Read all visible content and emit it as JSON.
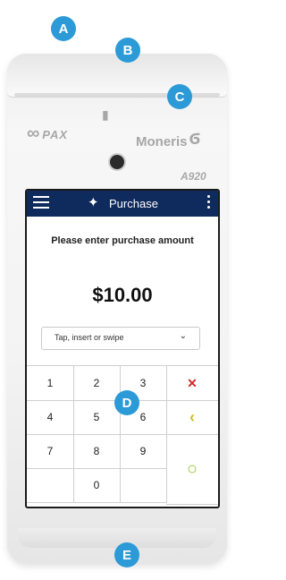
{
  "device": {
    "brand_left": "PAX",
    "brand_right": "Moneris",
    "model": "A920"
  },
  "screen": {
    "topbar": {
      "title": "Purchase"
    },
    "prompt": "Please enter purchase amount",
    "amount": "$10.00",
    "entry_method": {
      "selected": "Tap, insert or swipe"
    }
  },
  "keypad": {
    "rows": [
      [
        "1",
        "2",
        "3"
      ],
      [
        "4",
        "5",
        "6"
      ],
      [
        "7",
        "8",
        "9"
      ],
      [
        "",
        "0",
        ""
      ]
    ],
    "actions": {
      "cancel": "✕",
      "back": "‹",
      "ok": "○"
    }
  },
  "markers": [
    "A",
    "B",
    "C",
    "D",
    "E"
  ],
  "colors": {
    "marker": "#2d9ad8",
    "topbar": "#0f2a5c",
    "cancel": "#d12a2a",
    "back": "#c9c22a",
    "ok": "#9ac43a"
  },
  "icons": [
    "hamburger-icon",
    "tag-icon",
    "kebab-icon",
    "chevron-down-icon",
    "paper-icon",
    "camera-icon"
  ]
}
